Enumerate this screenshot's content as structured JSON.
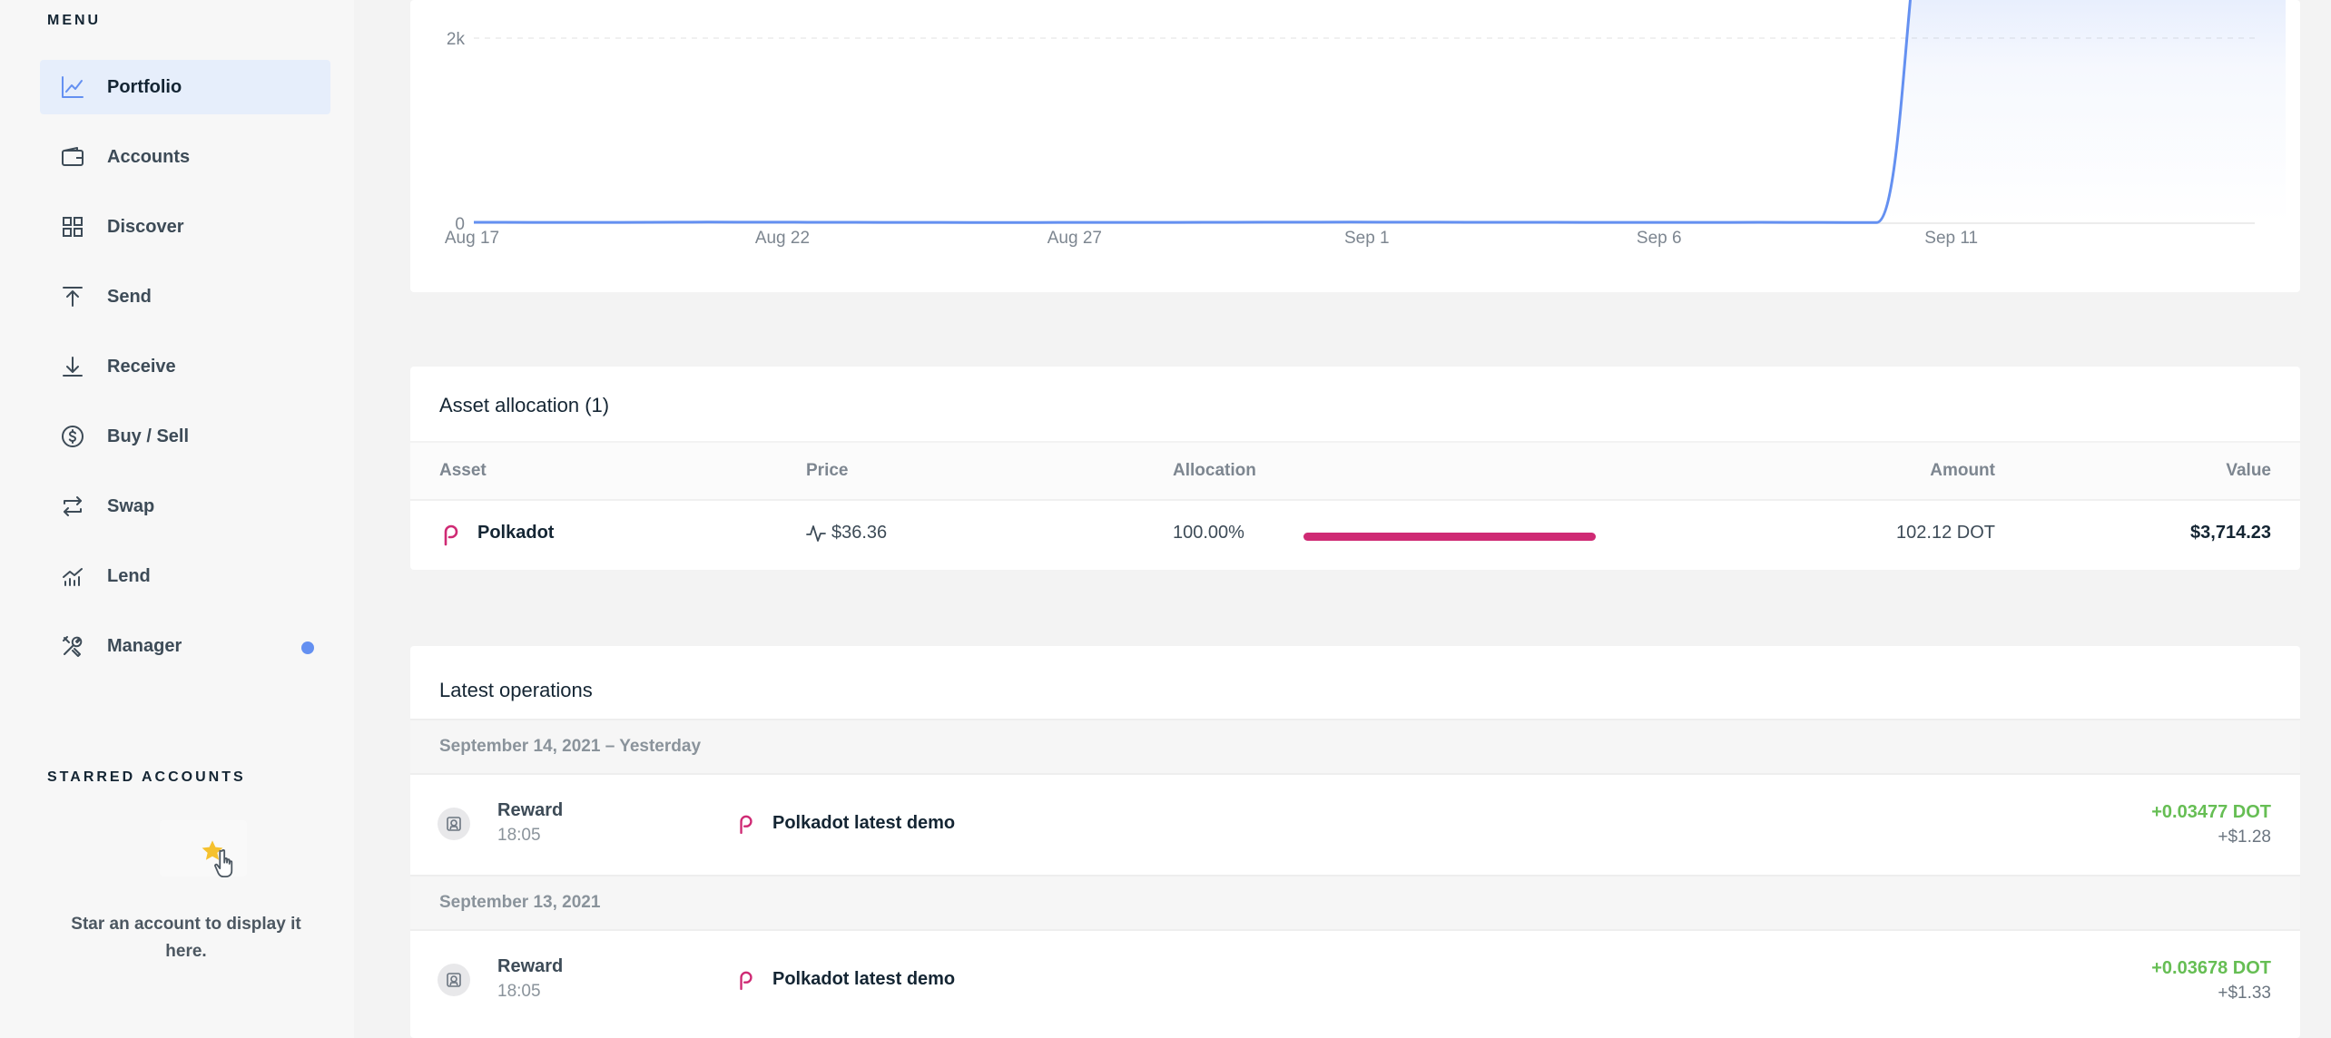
{
  "sidebar": {
    "menu_heading": "MENU",
    "items": [
      {
        "label": "Portfolio",
        "icon": "chart-line-icon"
      },
      {
        "label": "Accounts",
        "icon": "wallet-icon"
      },
      {
        "label": "Discover",
        "icon": "grid-icon"
      },
      {
        "label": "Send",
        "icon": "arrow-up-icon"
      },
      {
        "label": "Receive",
        "icon": "arrow-down-icon"
      },
      {
        "label": "Buy / Sell",
        "icon": "dollar-circle-icon"
      },
      {
        "label": "Swap",
        "icon": "swap-arrows-icon"
      },
      {
        "label": "Lend",
        "icon": "lend-chart-icon"
      },
      {
        "label": "Manager",
        "icon": "tools-icon"
      }
    ],
    "active_item": "Portfolio",
    "manager_notification_color": "#6490f1",
    "starred_heading": "STARRED ACCOUNTS",
    "starred_empty_text": "Star an account to display it here."
  },
  "chart_data": {
    "type": "area",
    "title": "",
    "xlabel": "",
    "ylabel": "",
    "x_ticks": [
      "Aug 17",
      "Aug 22",
      "Aug 27",
      "Sep 1",
      "Sep 6",
      "Sep 11"
    ],
    "y_ticks": [
      "0",
      "2k"
    ],
    "ylim": [
      0,
      2800
    ],
    "grid": true,
    "series": [
      {
        "color": "#6490f1",
        "x": [
          "Aug 17",
          "Aug 18",
          "Aug 19",
          "Aug 20",
          "Aug 21",
          "Aug 22",
          "Aug 23",
          "Aug 24",
          "Aug 25",
          "Aug 26",
          "Aug 27",
          "Aug 28",
          "Aug 29",
          "Aug 30",
          "Aug 31",
          "Sep 1",
          "Sep 2",
          "Sep 3",
          "Sep 4",
          "Sep 5",
          "Sep 6",
          "Sep 7",
          "Sep 8",
          "Sep 9",
          "Sep 10",
          "Sep 11",
          "Sep 12",
          "Sep 13",
          "Sep 14",
          "Sep 15",
          "Sep 16",
          "Sep 17"
        ],
        "values": [
          10,
          9,
          8,
          10,
          12,
          11,
          10,
          9,
          8,
          7,
          8,
          9,
          9,
          10,
          11,
          12,
          11,
          10,
          10,
          9,
          9,
          8,
          10,
          8,
          7,
          3700,
          3700,
          3710,
          3714,
          3714,
          3714,
          3714
        ]
      }
    ]
  },
  "asset_allocation": {
    "title": "Asset allocation (1)",
    "columns": [
      "Asset",
      "Price",
      "Allocation",
      "Amount",
      "Value"
    ],
    "rows": [
      {
        "asset": "Polkadot",
        "price": "$36.36",
        "allocation": "100.00%",
        "allocation_fraction": 1.0,
        "amount": "102.12 DOT",
        "value": "$3,714.23"
      }
    ],
    "bar_color": "#cf2a74"
  },
  "latest_operations": {
    "title": "Latest operations",
    "groups": [
      {
        "date": "September 14, 2021 – Yesterday",
        "ops": [
          {
            "type": "Reward",
            "time": "18:05",
            "account": "Polkadot latest demo",
            "amount": "+0.03477 DOT",
            "fiat": "+$1.28"
          }
        ]
      },
      {
        "date": "September 13, 2021",
        "ops": [
          {
            "type": "Reward",
            "time": "18:05",
            "account": "Polkadot latest demo",
            "amount": "+0.03678 DOT",
            "fiat": "+$1.33"
          }
        ]
      }
    ],
    "positive_color": "#66be54"
  }
}
